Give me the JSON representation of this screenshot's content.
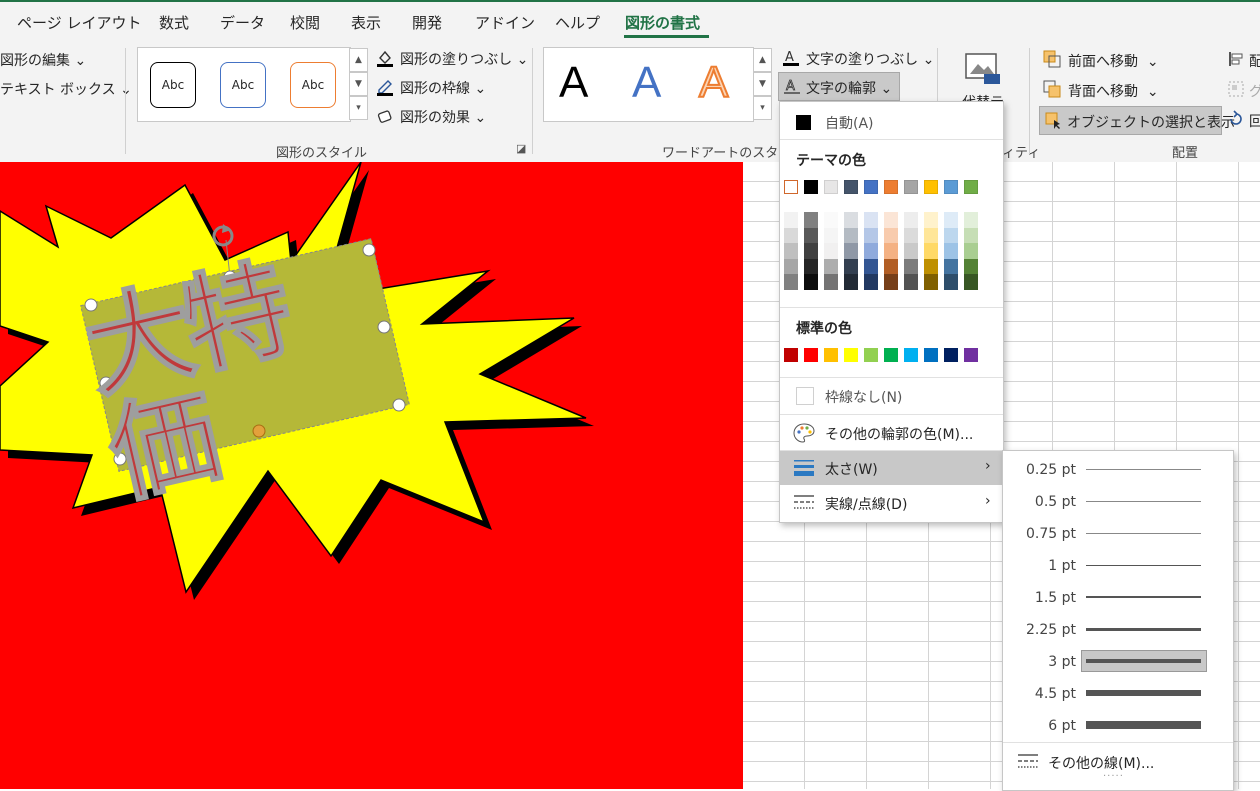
{
  "tabs": {
    "page_layout": "ページ レイアウト",
    "formulas": "数式",
    "data": "データ",
    "review": "校閲",
    "view": "表示",
    "developer": "開発",
    "addins": "アドイン",
    "help": "ヘルプ",
    "shape_format": "図形の書式"
  },
  "ribbon": {
    "insert_shapes": {
      "edit_shape": "図形の編集",
      "text_box": "テキスト ボックス"
    },
    "shape_styles": {
      "group_label": "図形のスタイル",
      "samples": [
        "Abc",
        "Abc",
        "Abc"
      ],
      "fill": "図形の塗りつぶし",
      "outline": "図形の枠線",
      "effects": "図形の効果"
    },
    "wordart_styles": {
      "group_label": "ワードアートのスタイル",
      "samples": [
        "A",
        "A",
        "A"
      ],
      "text_fill": "文字の塗りつぶし",
      "text_outline": "文字の輪郭"
    },
    "accessibility": {
      "alt_text": "代替テ",
      "group_label_tail": "ィティ"
    },
    "arrange": {
      "bring_forward": "前面へ移動",
      "send_backward": "背面へ移動",
      "selection_pane": "オブジェクトの選択と表示",
      "group_label": "配置",
      "align_cut": "配",
      "group_cut": "グ",
      "rotate_cut": "回"
    }
  },
  "canvas": {
    "shape_text": "大特価",
    "background_color": "#ff0000",
    "starburst_color": "#ffff00",
    "text_color": "#c0393b",
    "textbox_fill": "#b5b838"
  },
  "outline_menu": {
    "auto": "自動(A)",
    "theme_colors_title": "テーマの色",
    "standard_colors_title": "標準の色",
    "no_outline": "枠線なし(N)",
    "more_colors": "その他の輪郭の色(M)...",
    "weight": "太さ(W)",
    "dashes": "実線/点線(D)",
    "theme_colors": [
      "#ffffff",
      "#000000",
      "#e7e6e6",
      "#44546a",
      "#4472c4",
      "#ed7d31",
      "#a5a5a5",
      "#ffc000",
      "#5b9bd5",
      "#70ad47"
    ],
    "standard_colors": [
      "#c00000",
      "#ff0000",
      "#ffc000",
      "#ffff00",
      "#92d050",
      "#00b050",
      "#00b0f0",
      "#0070c0",
      "#002060",
      "#7030a0"
    ]
  },
  "weight_menu": {
    "items": [
      {
        "label": "0.25 pt",
        "weight_pt": 0.25
      },
      {
        "label": "0.5 pt",
        "weight_pt": 0.5
      },
      {
        "label": "0.75 pt",
        "weight_pt": 0.75
      },
      {
        "label": "1 pt",
        "weight_pt": 1
      },
      {
        "label": "1.5 pt",
        "weight_pt": 1.5
      },
      {
        "label": "2.25 pt",
        "weight_pt": 2.25
      },
      {
        "label": "3 pt",
        "weight_pt": 3
      },
      {
        "label": "4.5 pt",
        "weight_pt": 4.5
      },
      {
        "label": "6 pt",
        "weight_pt": 6
      }
    ],
    "selected": "3 pt",
    "more_lines": "その他の線(M)..."
  }
}
